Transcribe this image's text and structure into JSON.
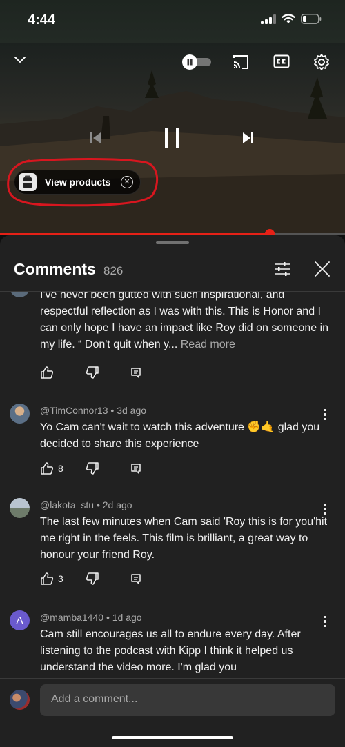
{
  "status": {
    "time": "4:44"
  },
  "video": {
    "products_label": "View products",
    "progress_fraction": 0.782
  },
  "comments_panel": {
    "title": "Comments",
    "count": "826",
    "comments": [
      {
        "author": "",
        "age": "",
        "text": "I've never been gutted with such inspirational, and respectful reflection as I was with this. This is Honor and I can only hope I have an impact like Roy did on someone in my life. “ Don't quit when y...",
        "more": "Read more",
        "likes": ""
      },
      {
        "author": "@TimConnor13",
        "age": "3d ago",
        "text": "Yo Cam can't wait to watch this adventure ✊🤙 glad you decided to share this experience",
        "likes": "8"
      },
      {
        "author": "@lakota_stu",
        "age": "2d ago",
        "text": "The last few minutes when Cam said 'Roy this is for you'hit me right in the feels. This film is brilliant, a great way to honour your friend Roy.",
        "likes": "3"
      },
      {
        "author": "@mamba1440",
        "age": "1d ago",
        "avatar_letter": "A",
        "text": "Cam still encourages us all to endure every day. After listening to the podcast with Kipp I think it helped us understand the video more. I'm glad you",
        "likes": ""
      }
    ],
    "add_comment_placeholder": "Add a comment..."
  },
  "colors": {
    "accent_red": "#e62117",
    "panel_bg": "#212121",
    "avatar_purple": "#6a5acd"
  },
  "separator": "•"
}
